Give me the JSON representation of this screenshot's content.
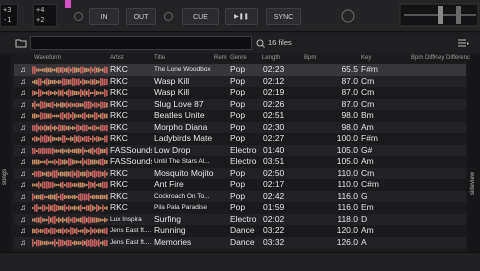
{
  "deck": {
    "lcd_left": [
      "+3",
      "-1"
    ],
    "lcd_mid": [
      "+4",
      "+2"
    ],
    "in_label": "IN",
    "out_label": "OUT",
    "cue_label": "CUE",
    "play_label": "▶❚❚",
    "sync_label": "SYNC"
  },
  "browser": {
    "search_placeholder": "",
    "file_count": "16 files",
    "left_tab_label": "songs",
    "right_tab_label": "sideview"
  },
  "columns": {
    "waveform": "Waveform",
    "artist": "Artist",
    "title": "Title",
    "remix": "Rem",
    "genre": "Genre",
    "length": "Length",
    "bpm": "Bpm",
    "key": "Key",
    "bpm_diff": "Bpm Diff",
    "key_diff": "Key Differenc"
  },
  "tracks": [
    {
      "artist": "RKC",
      "title": "The Lone Woodbox",
      "genre": "Pop",
      "length": "02:23",
      "bpm": "65.5",
      "key": "F#m",
      "small": true
    },
    {
      "artist": "RKC",
      "title": "Wasp Kill",
      "genre": "Pop",
      "length": "02:12",
      "bpm": "87.0",
      "key": "Cm",
      "small": false
    },
    {
      "artist": "RKC",
      "title": "Wasp Kill",
      "genre": "Pop",
      "length": "02:19",
      "bpm": "87.0",
      "key": "Cm",
      "small": false
    },
    {
      "artist": "RKC",
      "title": "Slug Love 87",
      "genre": "Pop",
      "length": "02:26",
      "bpm": "87.0",
      "key": "Cm",
      "small": false
    },
    {
      "artist": "RKC",
      "title": "Beatles Unite",
      "genre": "Pop",
      "length": "02:51",
      "bpm": "98.0",
      "key": "Bm",
      "small": false
    },
    {
      "artist": "RKC",
      "title": "Morpho Diana",
      "genre": "Pop",
      "length": "02:30",
      "bpm": "98.0",
      "key": "Am",
      "small": false
    },
    {
      "artist": "RKC",
      "title": "Ladybirds Mate",
      "genre": "Pop",
      "length": "02:27",
      "bpm": "100.0",
      "key": "F#m",
      "small": false
    },
    {
      "artist": "FASSounds",
      "title": "Low Drop",
      "genre": "Electro",
      "length": "01:40",
      "bpm": "105.0",
      "key": "G#",
      "small": false
    },
    {
      "artist": "FASSounds",
      "title": "Until The Stars Al...",
      "genre": "Electro",
      "length": "03:51",
      "bpm": "105.0",
      "key": "Am",
      "small": true
    },
    {
      "artist": "RKC",
      "title": "Mosquito Mojito",
      "genre": "Pop",
      "length": "02:50",
      "bpm": "110.0",
      "key": "Cm",
      "small": false
    },
    {
      "artist": "RKC",
      "title": "Ant Fire",
      "genre": "Pop",
      "length": "02:17",
      "bpm": "110.0",
      "key": "C#m",
      "small": false
    },
    {
      "artist": "RKC",
      "title": "Cockroach On To...",
      "genre": "Pop",
      "length": "02:42",
      "bpm": "116.0",
      "key": "G",
      "small": true
    },
    {
      "artist": "RKC",
      "title": "Pila Pala Paradise",
      "genre": "Pop",
      "length": "01:59",
      "bpm": "116.0",
      "key": "Em",
      "small": true
    },
    {
      "artist": "Lux Inspira",
      "title": "Surfing",
      "genre": "Electro",
      "length": "02:02",
      "bpm": "118.0",
      "key": "D",
      "small": false
    },
    {
      "artist": "Jens East ft....",
      "title": "Running",
      "genre": "Dance",
      "length": "03:22",
      "bpm": "120.0",
      "key": "Am",
      "small": false
    },
    {
      "artist": "Jens East ft....",
      "title": "Memories",
      "genre": "Dance",
      "length": "03:32",
      "bpm": "126.0",
      "key": "A",
      "small": false
    }
  ],
  "colors": {
    "accent": "#d74fc6",
    "waveform_hot": "#e26a6a",
    "waveform_warm": "#e4a070"
  }
}
